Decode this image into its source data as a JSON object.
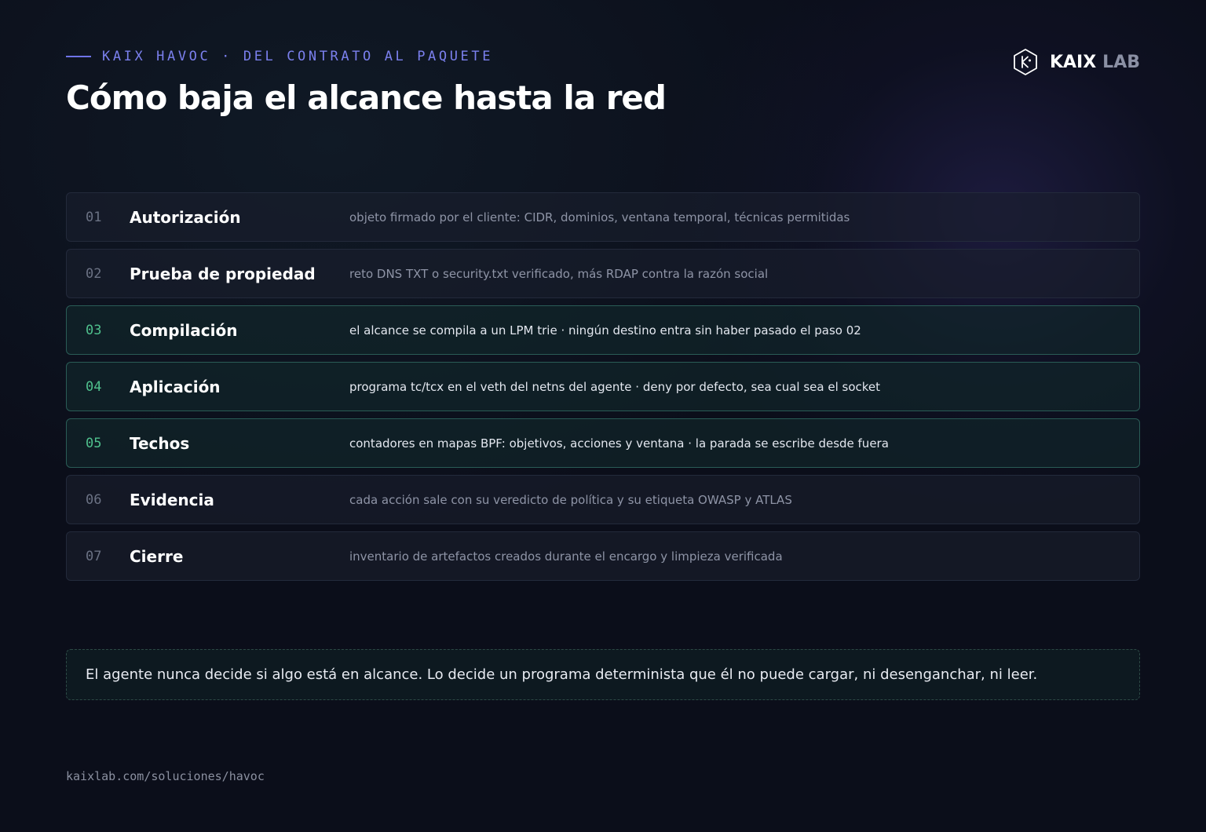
{
  "header": {
    "eyebrow": "KAIX HAVOC · DEL CONTRATO AL PAQUETE",
    "title": "Cómo baja el alcance hasta la red"
  },
  "logo": {
    "icon": "kaix-hexagon-logo-icon",
    "word_primary": "KAIX",
    "word_secondary": "LAB"
  },
  "steps": [
    {
      "num": "01",
      "title": "Autorización",
      "desc": "objeto firmado por el cliente: CIDR, dominios, ventana temporal, técnicas permitidas",
      "highlighted": false
    },
    {
      "num": "02",
      "title": "Prueba de propiedad",
      "desc": "reto DNS TXT o security.txt verificado, más RDAP contra la razón social",
      "highlighted": false
    },
    {
      "num": "03",
      "title": "Compilación",
      "desc": "el alcance se compila a un LPM trie · ningún destino entra sin haber pasado el paso 02",
      "highlighted": true
    },
    {
      "num": "04",
      "title": "Aplicación",
      "desc": "programa tc/tcx en el veth del netns del agente · deny por defecto, sea cual sea el socket",
      "highlighted": true
    },
    {
      "num": "05",
      "title": "Techos",
      "desc": "contadores en mapas BPF: objetivos, acciones y ventana · la parada se escribe desde fuera",
      "highlighted": true
    },
    {
      "num": "06",
      "title": "Evidencia",
      "desc": "cada acción sale con su veredicto de política y su etiqueta OWASP y ATLAS",
      "highlighted": false
    },
    {
      "num": "07",
      "title": "Cierre",
      "desc": "inventario de artefactos creados durante el encargo y limpieza verificada",
      "highlighted": false
    }
  ],
  "callout": {
    "text": "El agente nunca decide si algo está en alcance. Lo decide un programa determinista que él no puede cargar, ni desenganchar, ni leer."
  },
  "footer": {
    "url": "kaixlab.com/soluciones/havoc"
  },
  "colors": {
    "background": "#0b0e1a",
    "accent_indigo": "#7b80ee",
    "accent_green": "#4fc08d",
    "highlight_border": "#2a5c56"
  }
}
